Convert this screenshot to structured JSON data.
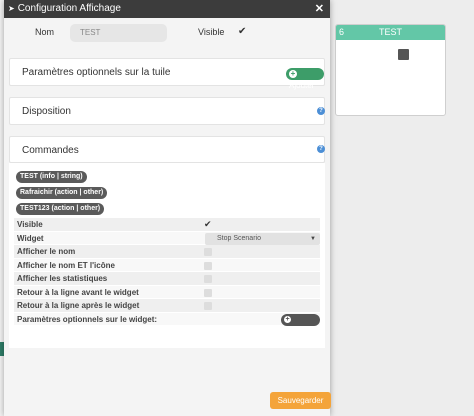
{
  "modal": {
    "title": "Configuration Affichage",
    "title_icon": "expand-icon",
    "close_glyph": "✕",
    "nom_label": "Nom",
    "nom_value": "TEST",
    "visible_label": "Visible",
    "visible_checked": true
  },
  "panels": {
    "params": {
      "title": "Paramètres optionnels sur la tuile",
      "add_label": "Ajouter"
    },
    "disposition": {
      "title": "Disposition"
    },
    "commandes": {
      "title": "Commandes"
    }
  },
  "commands": [
    "TEST (info | string)",
    "Rafraichir (action | other)",
    "TEST123 (action | other)"
  ],
  "config": {
    "visible_label": "Visible",
    "widget_label": "Widget",
    "widget_value": "Stop Scenario",
    "afficher_nom": "Afficher le nom",
    "afficher_nom_icone": "Afficher le nom ET l'icône",
    "afficher_stats": "Afficher les statistiques",
    "retour_avant": "Retour à la ligne avant le widget",
    "retour_apres": "Retour à la ligne après le widget",
    "params_widget": "Paramètres optionnels sur le widget:",
    "add_label": "Ajouter"
  },
  "save_label": "Sauvegarder",
  "tile": {
    "number": "6",
    "title": "TEST"
  },
  "colors": {
    "title_bar": "#3c3c3c",
    "add_button": "#3d9d69",
    "save_button": "#f4a43a",
    "tile_header": "#63c7a7",
    "help_icon": "#4c8fd6",
    "badge": "#5a5a5a"
  }
}
